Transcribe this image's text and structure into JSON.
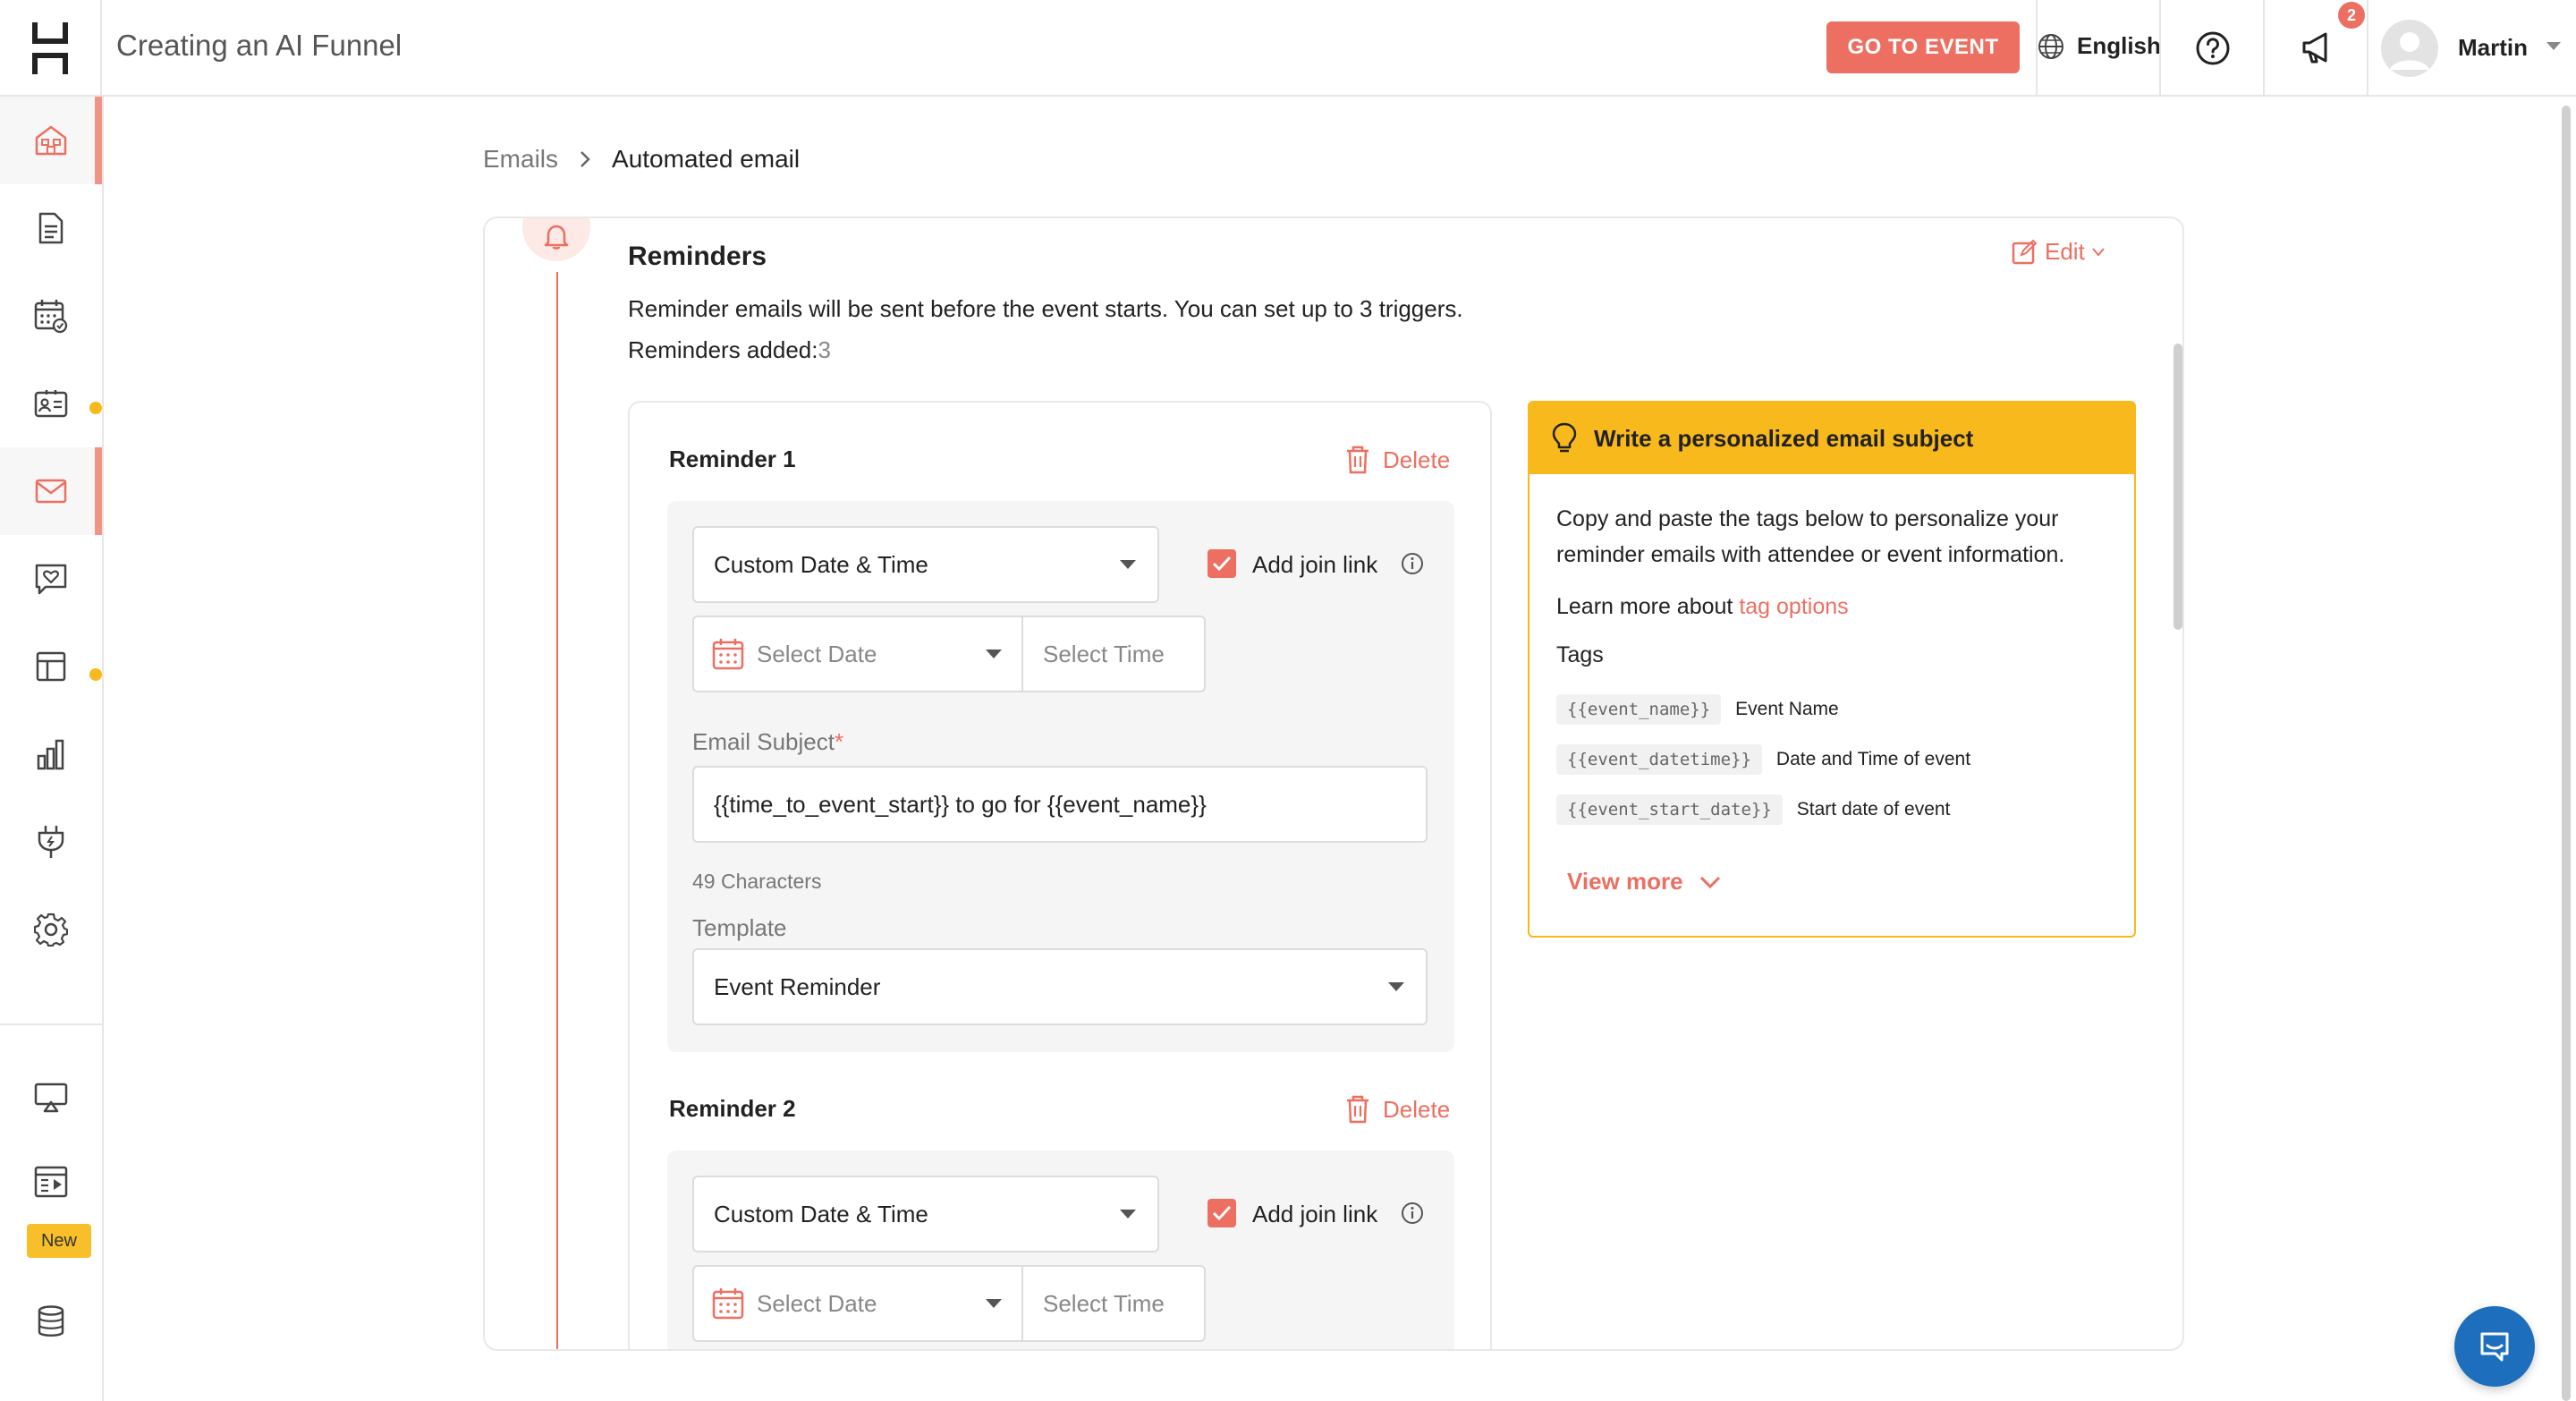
{
  "app": {
    "title": "Creating an AI Funnel"
  },
  "topbar": {
    "go_to_event": "GO TO EVENT",
    "language": "English",
    "notification_count": "2",
    "user_name": "Martin"
  },
  "sidebar": {
    "items": [
      {
        "icon": "home-icon",
        "active": true,
        "dot": false
      },
      {
        "icon": "document-icon",
        "active": false,
        "dot": false
      },
      {
        "icon": "calendar-icon",
        "active": false,
        "dot": false
      },
      {
        "icon": "contact-card-icon",
        "active": false,
        "dot": true
      },
      {
        "icon": "mail-icon",
        "active": true,
        "dot": false
      },
      {
        "icon": "chat-heart-icon",
        "active": false,
        "dot": false
      },
      {
        "icon": "layout-icon",
        "active": false,
        "dot": true
      },
      {
        "icon": "bar-chart-icon",
        "active": false,
        "dot": false
      },
      {
        "icon": "plug-icon",
        "active": false,
        "dot": false
      },
      {
        "icon": "settings-icon",
        "active": false,
        "dot": false
      },
      {
        "icon": "screen-share-icon",
        "active": false,
        "dot": false
      },
      {
        "icon": "video-layout-icon",
        "active": false,
        "dot": false
      },
      {
        "icon": "database-icon",
        "active": false,
        "dot": false
      }
    ],
    "new_badge": "New"
  },
  "breadcrumb": {
    "parent": "Emails",
    "current": "Automated email"
  },
  "section": {
    "title": "Reminders",
    "edit_label": "Edit",
    "description": "Reminder emails will be sent before the event starts. You can set up to 3 triggers.",
    "count_label": "Reminders added:",
    "count_value": "3"
  },
  "reminders": [
    {
      "title": "Reminder 1",
      "delete_label": "Delete",
      "schedule": "Custom Date & Time",
      "join_link_label": "Add join link",
      "join_link_checked": true,
      "date_placeholder": "Select Date",
      "time_placeholder": "Select Time",
      "subject_label": "Email Subject",
      "subject_value": "{{time_to_event_start}} to go for {{event_name}}",
      "char_count": "49 Characters",
      "template_label": "Template",
      "template_value": "Event Reminder"
    },
    {
      "title": "Reminder 2",
      "delete_label": "Delete",
      "schedule": "Custom Date & Time",
      "join_link_label": "Add join link",
      "join_link_checked": true,
      "date_placeholder": "Select Date",
      "time_placeholder": "Select Time"
    }
  ],
  "tip": {
    "title": "Write a personalized email subject",
    "body": "Copy and paste the tags below to personalize your reminder emails with attendee or event information.",
    "learn_prefix": "Learn more about",
    "learn_link": "tag options",
    "tags_label": "Tags",
    "tags": [
      {
        "code": "{{event_name}}",
        "desc": "Event Name"
      },
      {
        "code": "{{event_datetime}}",
        "desc": "Date and Time of event"
      },
      {
        "code": "{{event_start_date}}",
        "desc": "Start date of event"
      }
    ],
    "view_more": "View more"
  },
  "colors": {
    "accent": "#ec6f61",
    "tip": "#f8b91c",
    "chat": "#1d6fbd"
  }
}
